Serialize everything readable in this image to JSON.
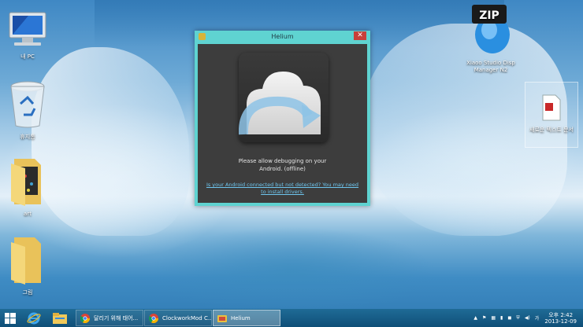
{
  "desktop": {
    "icons": [
      {
        "label": "내 PC",
        "icon": "computer-icon"
      },
      {
        "label": "휴지통",
        "icon": "recycle-bin-icon"
      },
      {
        "label": "art",
        "icon": "folder-icon"
      },
      {
        "label": "그림",
        "icon": "folder-icon"
      },
      {
        "label": "Xiaoo Studio Disp Manager N2",
        "icon": "zip-archive-icon",
        "badge": "ZIP"
      },
      {
        "label": "새로운 텍스트 문서",
        "icon": "document-icon"
      }
    ]
  },
  "window": {
    "title": "Helium",
    "close_glyph": "✕",
    "message_line1": "Please allow debugging on your",
    "message_line2": "Android. (offline)",
    "link_text": "Is your Android connected but not detected? You may need to install drivers."
  },
  "taskbar": {
    "tasks": [
      {
        "label": "달리기 위해 태어...",
        "icon": "chrome-icon",
        "active": false
      },
      {
        "label": "ClockworkMod C...",
        "icon": "chrome-icon",
        "active": false
      },
      {
        "label": "Helium",
        "icon": "helium-icon",
        "active": true
      }
    ],
    "clock": {
      "time": "오후 2:42",
      "date": "2013-12-09"
    }
  },
  "colors": {
    "window_frame": "#5fd3d1",
    "window_client": "#3d3d3d",
    "taskbar": "#1f6b96",
    "link": "#6ec6ef",
    "close_button": "#c7403a"
  }
}
